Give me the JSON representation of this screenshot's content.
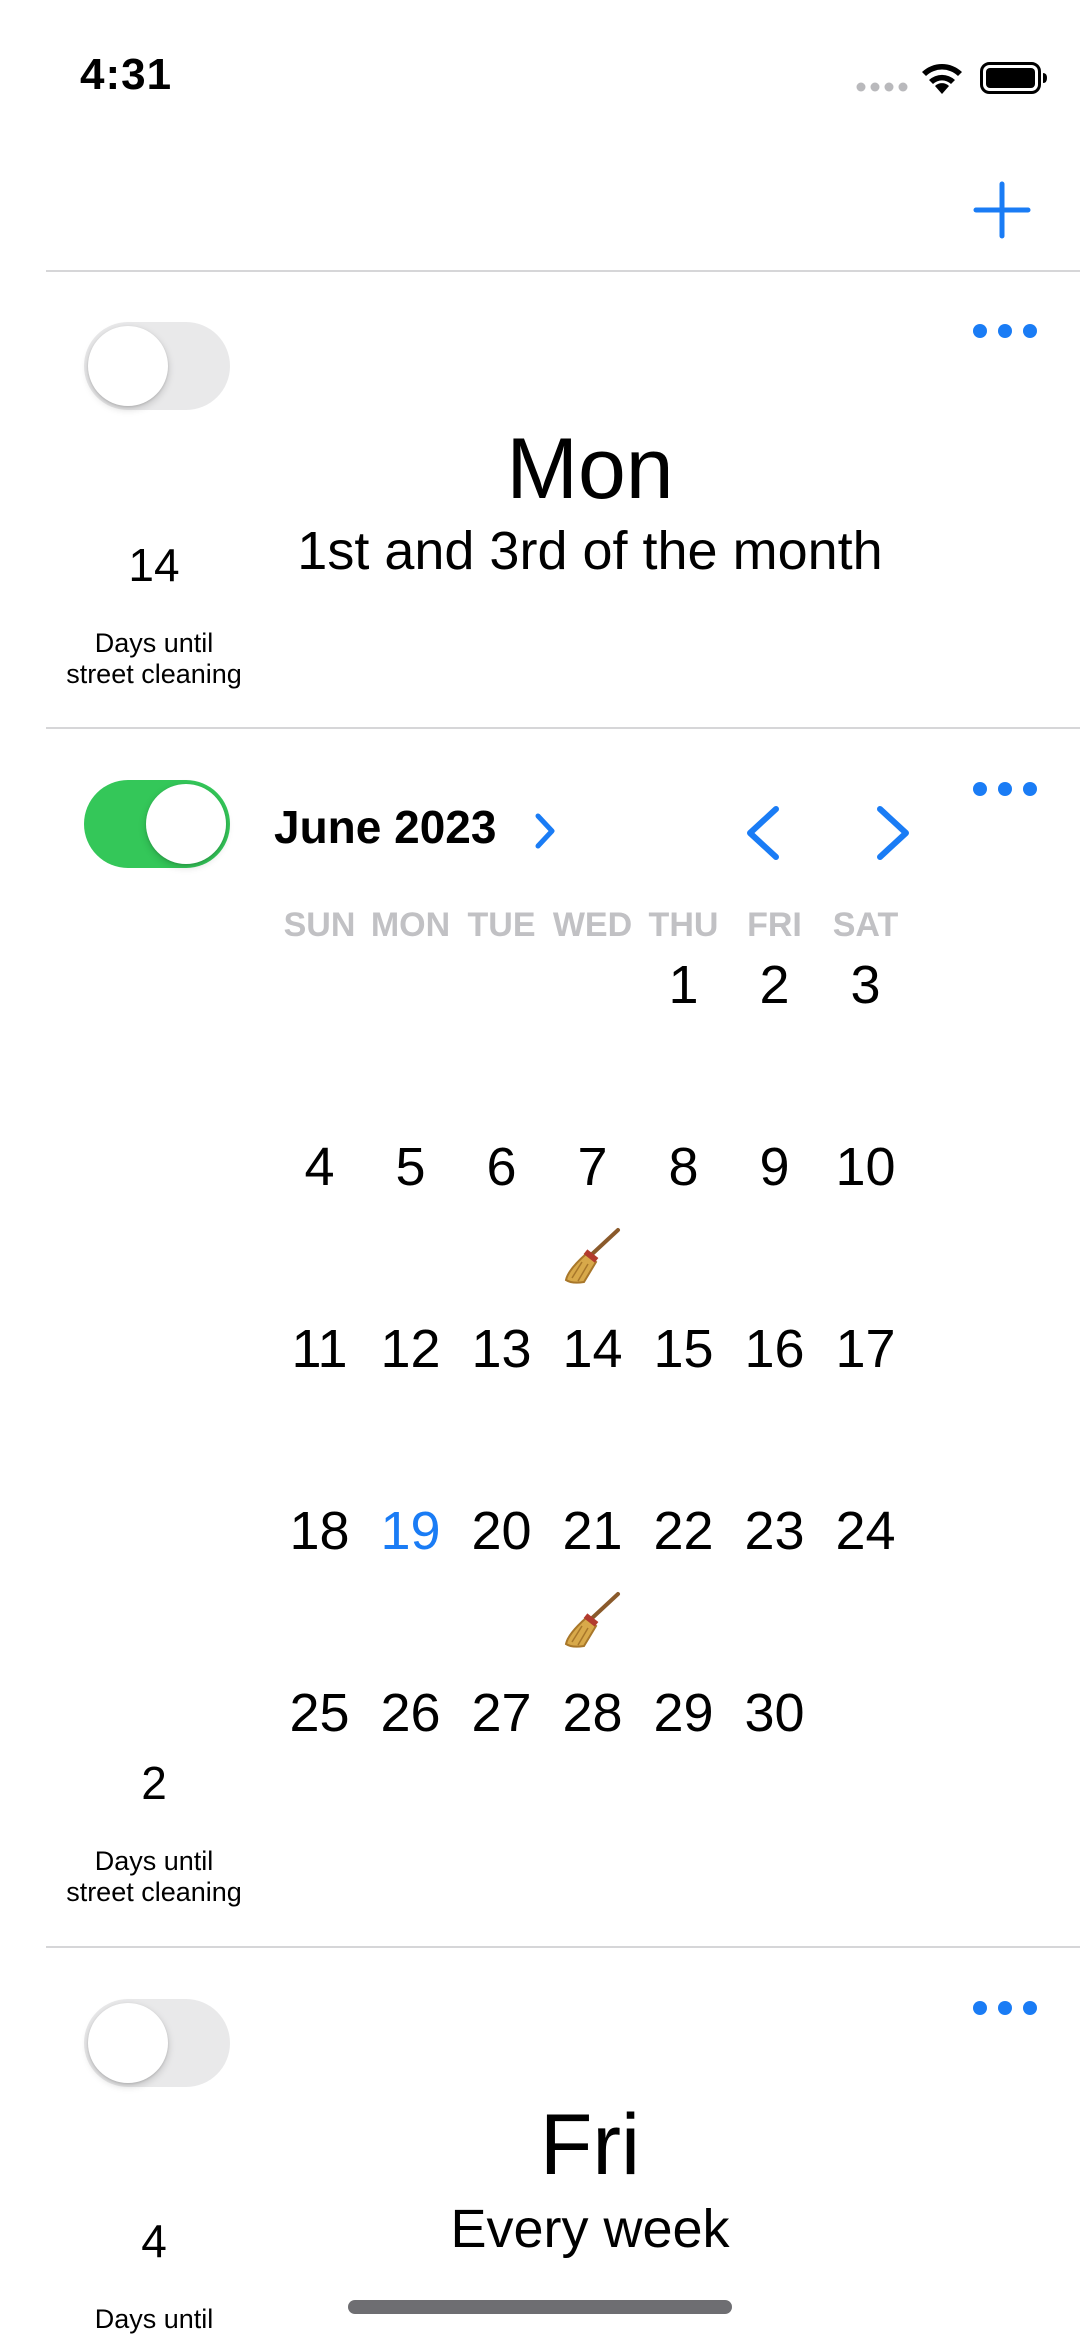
{
  "status_bar": {
    "time": "4:31",
    "icons": [
      "cellular-signal-icon",
      "wifi-icon",
      "battery-icon"
    ]
  },
  "toolbar": {
    "add_icon": "plus-icon"
  },
  "colors": {
    "accent": "#1a7cf5",
    "toggle_on": "#34c759",
    "toggle_off": "#e9e9ea",
    "weekday_header": "#c1c1c4"
  },
  "schedules": [
    {
      "enabled": false,
      "day": "Mon",
      "frequency": "1st and 3rd of the month",
      "days_until": "14",
      "days_until_label_1": "Days until",
      "days_until_label_2": "street cleaning"
    },
    {
      "enabled": true,
      "days_until": "2",
      "days_until_label_1": "Days until",
      "days_until_label_2": "street cleaning",
      "calendar": {
        "month_title": "June 2023",
        "weekdays": [
          "SUN",
          "MON",
          "TUE",
          "WED",
          "THU",
          "FRI",
          "SAT"
        ],
        "first_weekday_index": 4,
        "days_in_month": 30,
        "today": 19,
        "cleaning_days": [
          14,
          28
        ],
        "cleaning_icon": "broom-icon",
        "days": [
          "1",
          "2",
          "3",
          "4",
          "5",
          "6",
          "7",
          "8",
          "9",
          "10",
          "11",
          "12",
          "13",
          "14",
          "15",
          "16",
          "17",
          "18",
          "19",
          "20",
          "21",
          "22",
          "23",
          "24",
          "25",
          "26",
          "27",
          "28",
          "29",
          "30"
        ]
      }
    },
    {
      "enabled": false,
      "day": "Fri",
      "frequency": "Every week",
      "days_until": "4",
      "days_until_label_1": "Days until"
    }
  ]
}
